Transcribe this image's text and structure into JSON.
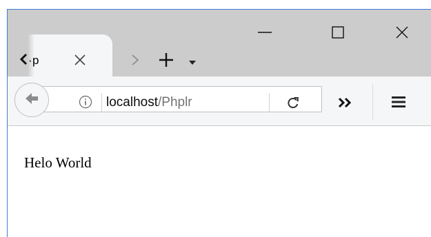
{
  "browser": {
    "tab": {
      "title_visible": "·p"
    },
    "urlbar": {
      "host": "localhost",
      "path": "/Phplr"
    },
    "icons": {
      "tab_scroll_left": "chevron-left-icon",
      "tab_close": "close-icon",
      "tab_scroll_right": "chevron-right-icon",
      "new_tab": "plus-icon",
      "tab_list": "caret-down-icon",
      "minimize": "minimize-icon",
      "maximize": "maximize-icon",
      "close_window": "close-icon",
      "back": "arrow-left-icon",
      "site_info": "info-icon",
      "reload": "reload-icon",
      "overflow": "double-chevron-right-icon",
      "menu": "hamburger-icon"
    },
    "colors": {
      "tabstrip": "#cccccc",
      "toolbar": "#f5f6f7",
      "window_border": "#3d7bd6",
      "url_path": "#737373"
    }
  },
  "page": {
    "text": "Helo World"
  }
}
